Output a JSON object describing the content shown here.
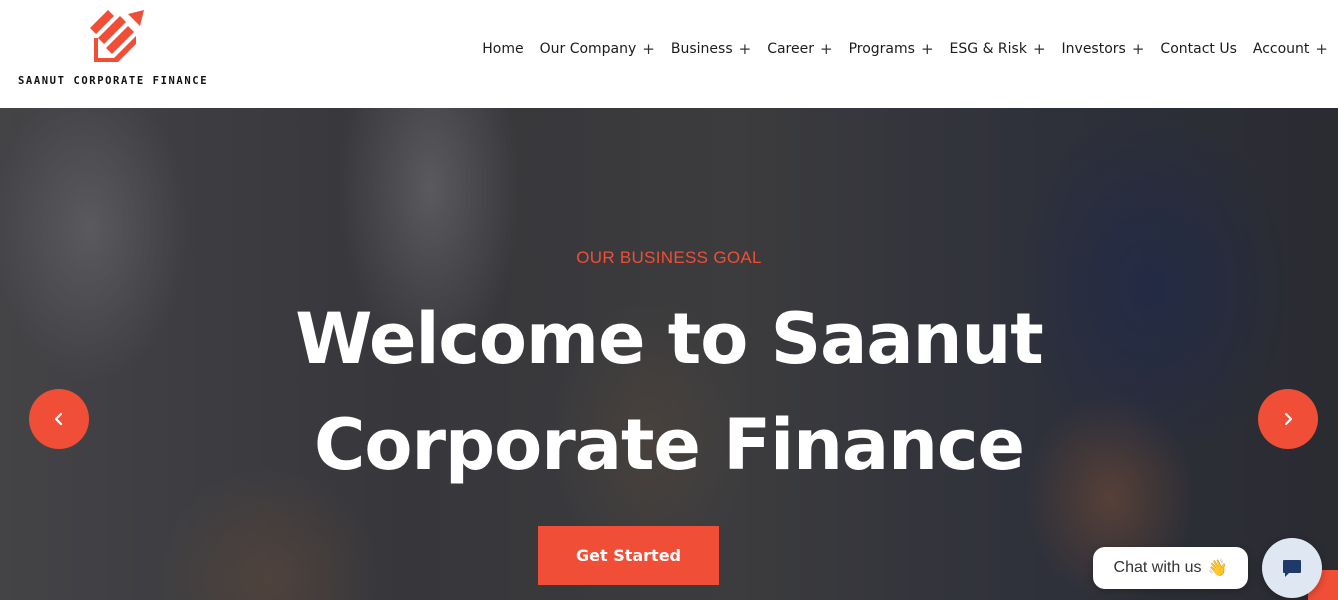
{
  "brand": {
    "name": "SAANUT CORPORATE FINANCE",
    "accent_color": "#f04e36"
  },
  "nav": {
    "items": [
      {
        "label": "Home",
        "has_submenu": false
      },
      {
        "label": "Our Company",
        "has_submenu": true
      },
      {
        "label": "Business",
        "has_submenu": true
      },
      {
        "label": "Career",
        "has_submenu": true
      },
      {
        "label": "Programs",
        "has_submenu": true
      },
      {
        "label": "ESG & Risk",
        "has_submenu": true
      },
      {
        "label": "Investors",
        "has_submenu": true
      },
      {
        "label": "Contact Us",
        "has_submenu": false
      },
      {
        "label": "Account",
        "has_submenu": true
      }
    ],
    "submenu_icon": "plus-icon",
    "submenu_glyph": "+"
  },
  "hero": {
    "eyebrow": "OUR BUSINESS GOAL",
    "headline_line1": "Welcome to Saanut",
    "headline_line2": "Corporate Finance",
    "cta_label": "Get Started",
    "prev_icon": "chevron-left-icon",
    "next_icon": "chevron-right-icon"
  },
  "chat": {
    "label": "Chat with us",
    "emoji": "👋",
    "button_icon": "chat-icon"
  }
}
